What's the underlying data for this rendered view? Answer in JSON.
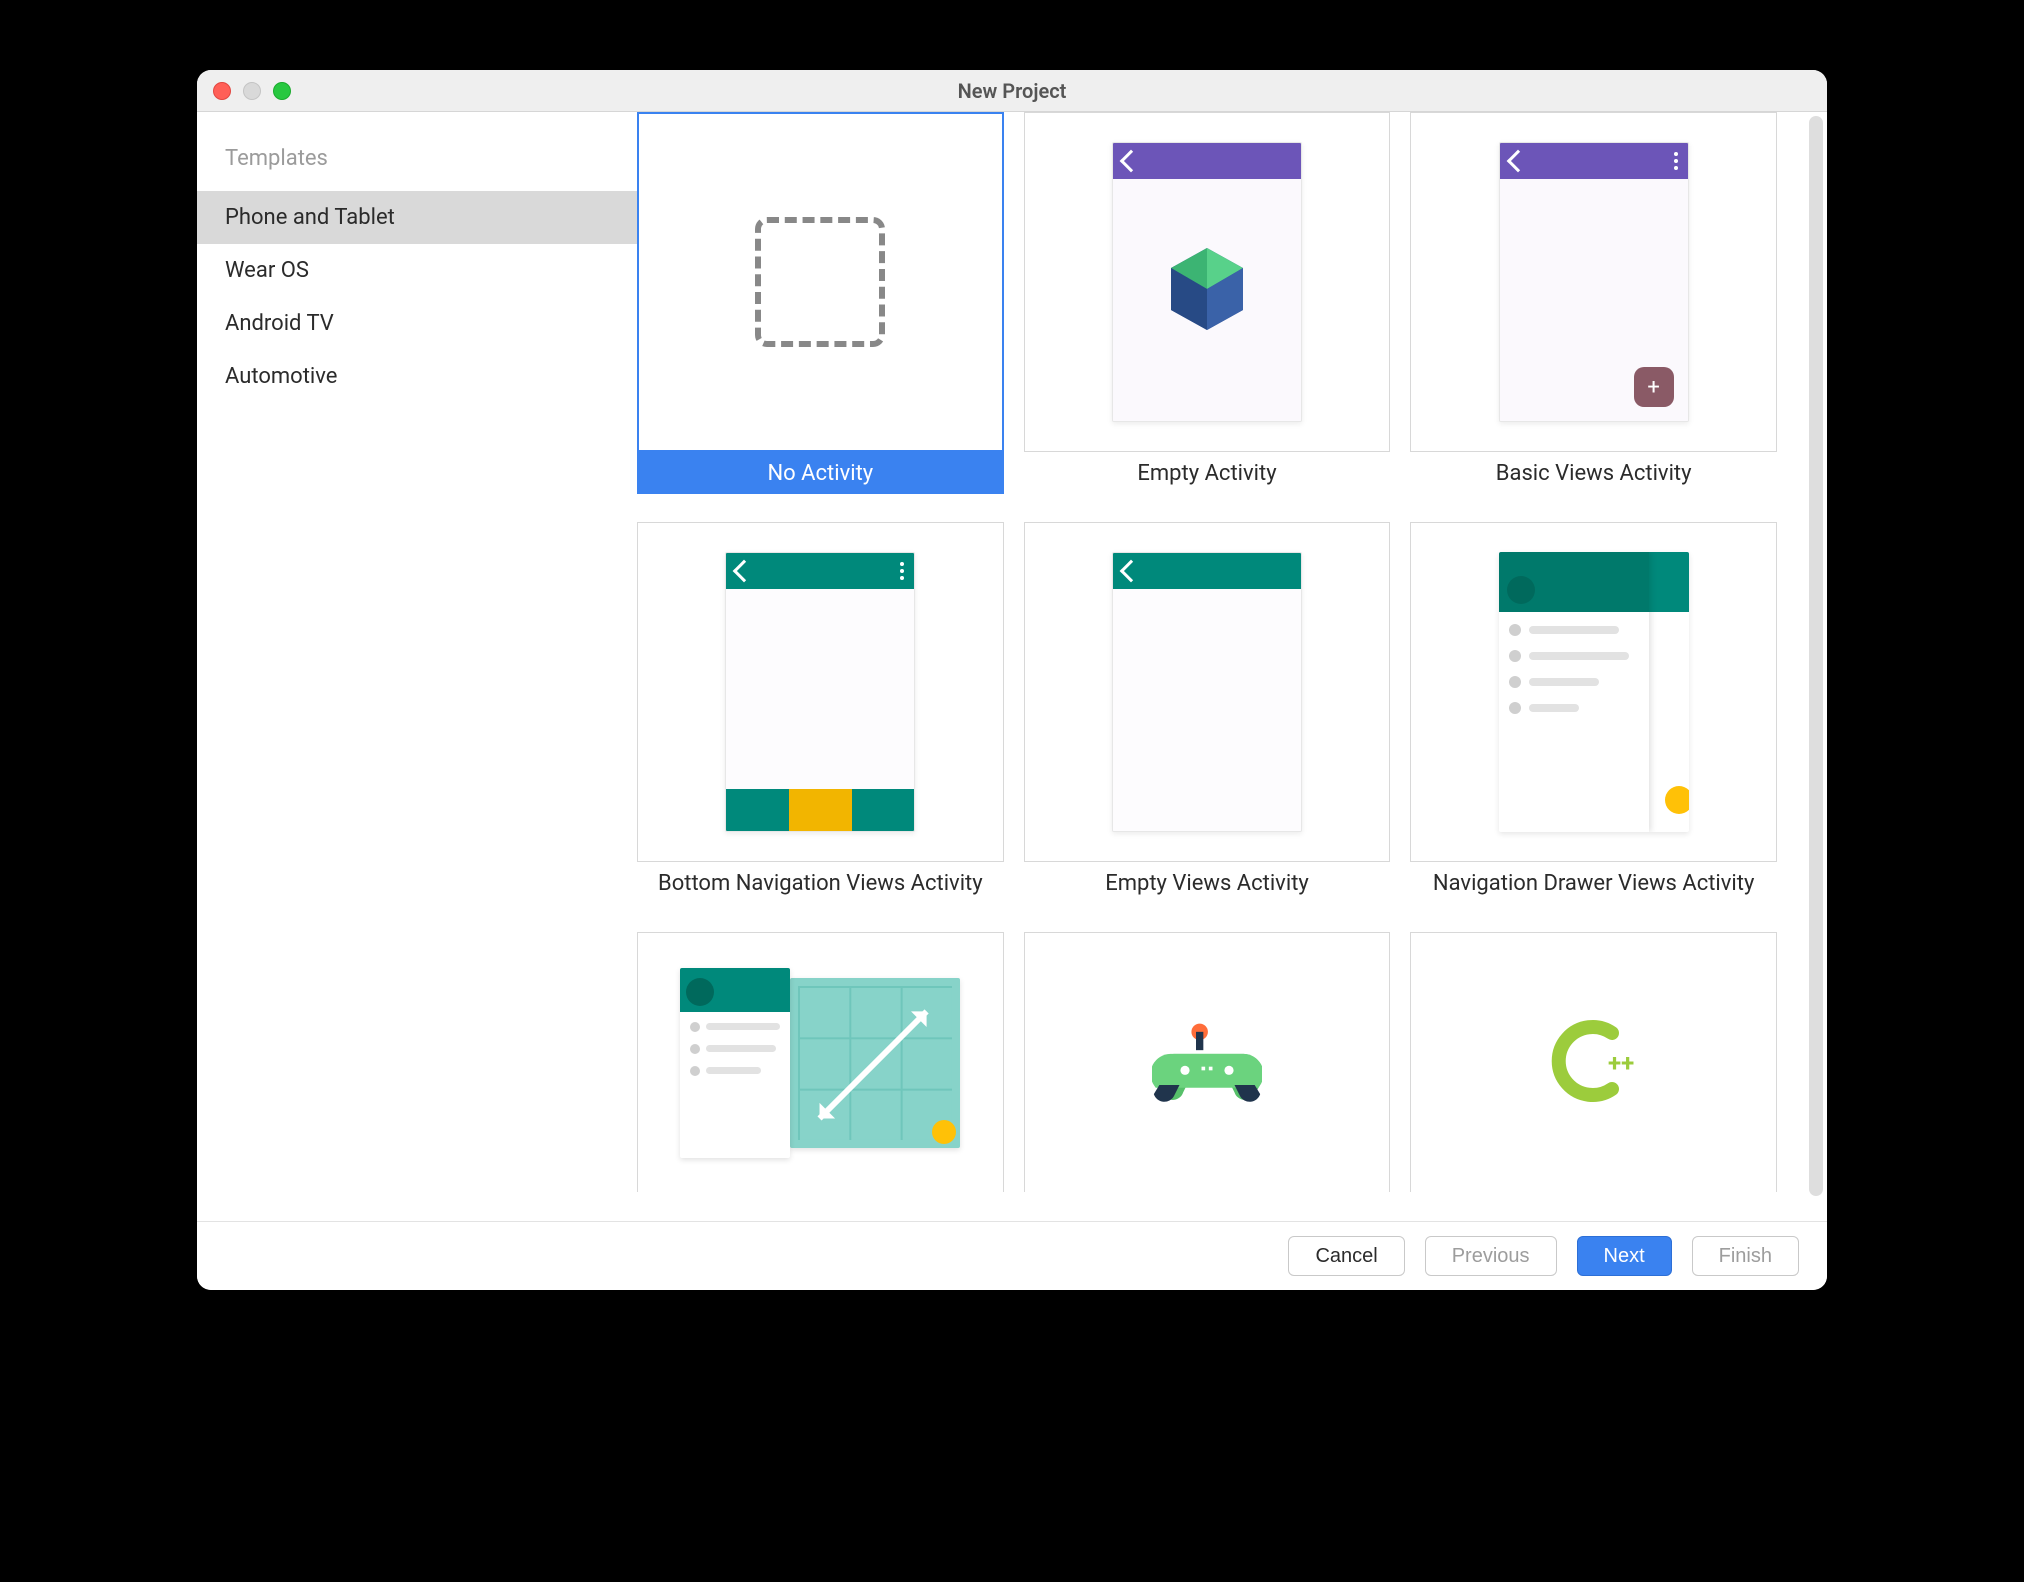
{
  "window": {
    "title": "New Project"
  },
  "sidebar": {
    "header": "Templates",
    "items": [
      {
        "label": "Phone and Tablet",
        "selected": true
      },
      {
        "label": "Wear OS",
        "selected": false
      },
      {
        "label": "Android TV",
        "selected": false
      },
      {
        "label": "Automotive",
        "selected": false
      }
    ]
  },
  "templates": [
    {
      "label": "No Activity",
      "selected": true
    },
    {
      "label": "Empty Activity",
      "selected": false
    },
    {
      "label": "Basic Views Activity",
      "selected": false
    },
    {
      "label": "Bottom Navigation Views Activity",
      "selected": false
    },
    {
      "label": "Empty Views Activity",
      "selected": false
    },
    {
      "label": "Navigation Drawer Views Activity",
      "selected": false
    },
    {
      "label": "",
      "selected": false
    },
    {
      "label": "",
      "selected": false
    },
    {
      "label": "",
      "selected": false
    }
  ],
  "footer": {
    "cancel": "Cancel",
    "previous": "Previous",
    "next": "Next",
    "finish": "Finish"
  },
  "colors": {
    "accent": "#3a82f0",
    "teal": "#00897b",
    "purple": "#6c55b8",
    "amber": "#f2b500"
  }
}
